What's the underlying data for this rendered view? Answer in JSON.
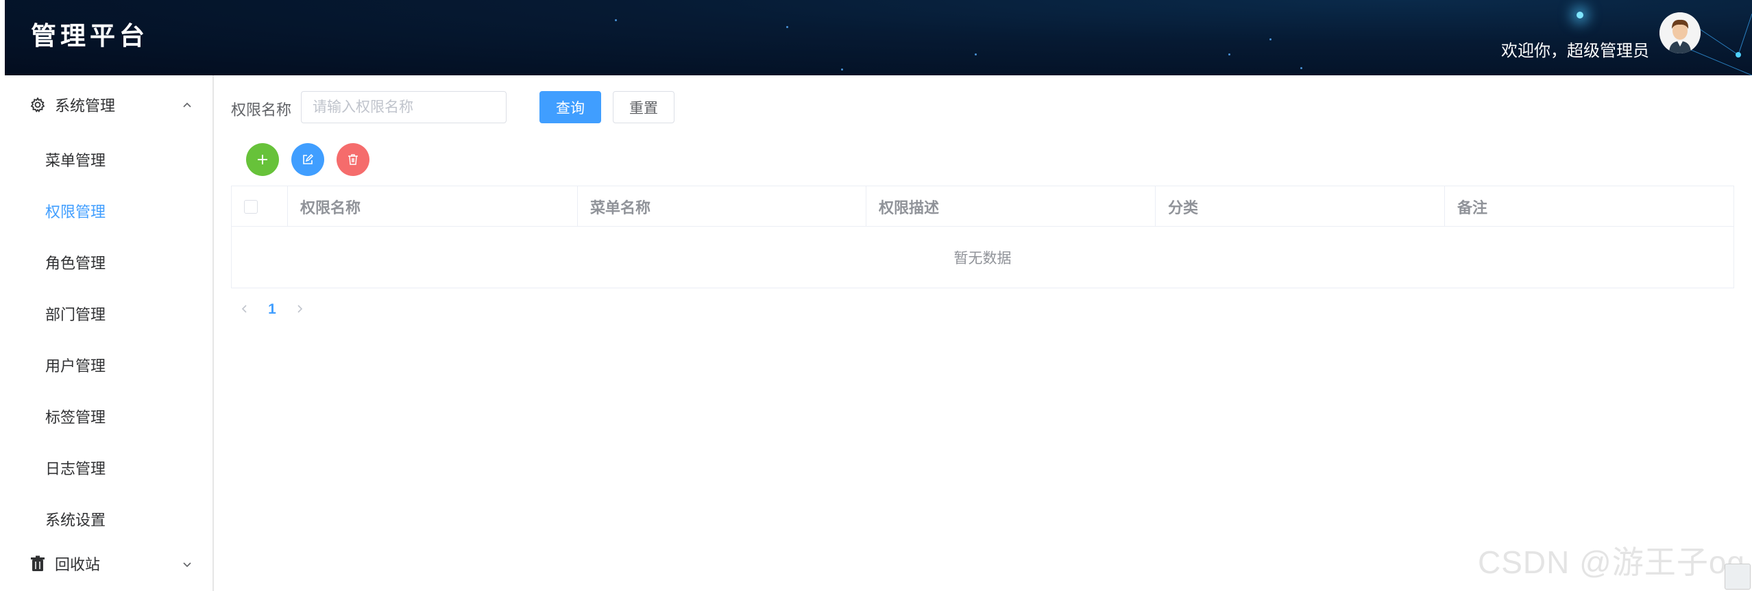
{
  "header": {
    "brand": "管理平台",
    "welcome": "欢迎你，超级管理员",
    "avatar_icon": "user-avatar"
  },
  "sidebar": {
    "group_system": {
      "label": "系统管理",
      "icon": "gear-icon",
      "expanded": true
    },
    "items": [
      {
        "label": "菜单管理",
        "active": false
      },
      {
        "label": "权限管理",
        "active": true
      },
      {
        "label": "角色管理",
        "active": false
      },
      {
        "label": "部门管理",
        "active": false
      },
      {
        "label": "用户管理",
        "active": false
      },
      {
        "label": "标签管理",
        "active": false
      },
      {
        "label": "日志管理",
        "active": false
      },
      {
        "label": "系统设置",
        "active": false
      }
    ],
    "group_recycle": {
      "label": "回收站",
      "icon": "trash-icon",
      "expanded": false
    }
  },
  "search": {
    "label": "权限名称",
    "placeholder": "请输入权限名称",
    "value": "",
    "query_label": "查询",
    "reset_label": "重置"
  },
  "actions": {
    "add_icon": "plus-icon",
    "edit_icon": "edit-icon",
    "delete_icon": "delete-icon"
  },
  "table": {
    "columns": [
      "权限名称",
      "菜单名称",
      "权限描述",
      "分类",
      "备注"
    ],
    "empty_text": "暂无数据"
  },
  "pagination": {
    "current_page": "1"
  },
  "watermark": "CSDN @游王子og",
  "colors": {
    "primary": "#409eff",
    "success": "#67c23a",
    "danger": "#f56c6c",
    "header_bg": "#030d1f"
  }
}
